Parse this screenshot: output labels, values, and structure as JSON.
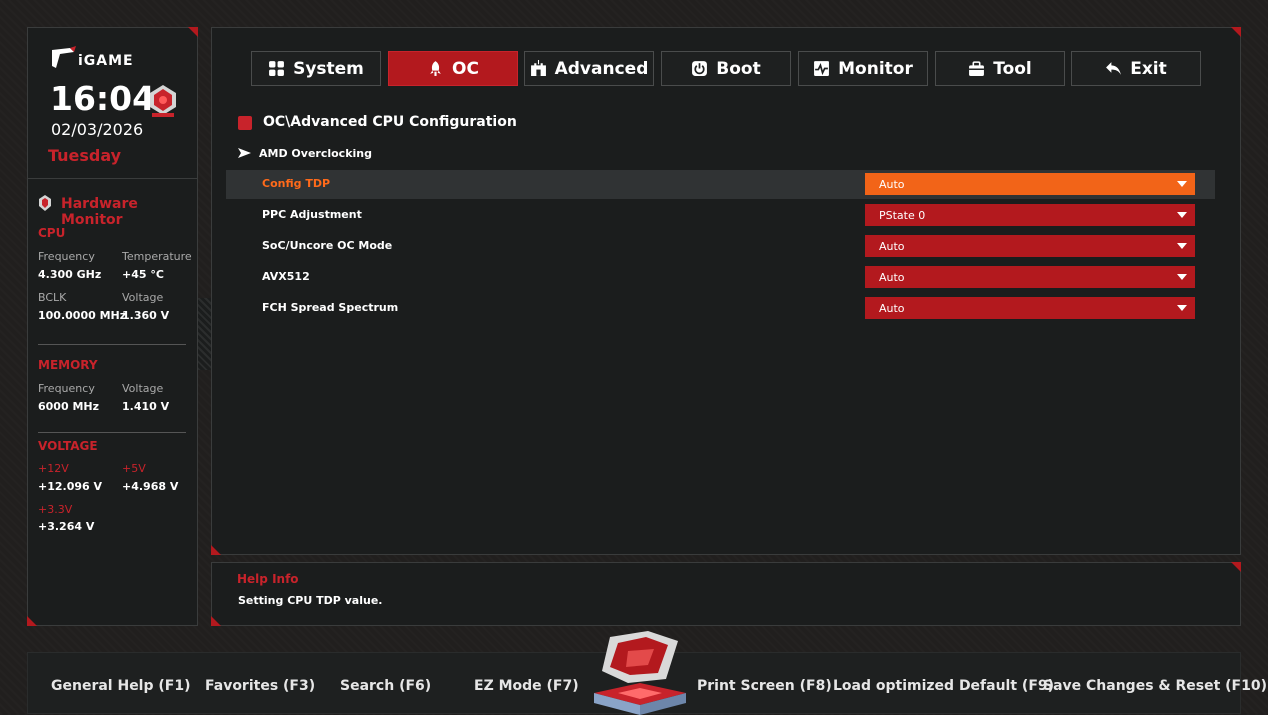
{
  "sidebar": {
    "brand": "iGAME",
    "time": "16:04",
    "date": "02/03/2026",
    "weekday": "Tuesday",
    "hardware_monitor_title": "Hardware Monitor",
    "cpu": {
      "heading": "CPU",
      "frequency_label": "Frequency",
      "frequency_value": "4.300 GHz",
      "temperature_label": "Temperature",
      "temperature_value": "+45 °C",
      "bclk_label": "BCLK",
      "bclk_value": "100.0000 MHz",
      "voltage_label": "Voltage",
      "voltage_value": "1.360 V"
    },
    "memory": {
      "heading": "MEMORY",
      "frequency_label": "Frequency",
      "frequency_value": "6000 MHz",
      "voltage_label": "Voltage",
      "voltage_value": "1.410 V"
    },
    "voltage": {
      "heading": "VOLTAGE",
      "v12_label": "+12V",
      "v12_value": "+12.096 V",
      "v5_label": "+5V",
      "v5_value": "+4.968 V",
      "v33_label": "+3.3V",
      "v33_value": "+3.264 V"
    }
  },
  "tabs": [
    {
      "label": "System",
      "icon": "grid-icon"
    },
    {
      "label": "OC",
      "icon": "rocket-icon"
    },
    {
      "label": "Advanced",
      "icon": "castle-icon"
    },
    {
      "label": "Boot",
      "icon": "power-icon"
    },
    {
      "label": "Monitor",
      "icon": "pulse-icon"
    },
    {
      "label": "Tool",
      "icon": "toolbox-icon"
    },
    {
      "label": "Exit",
      "icon": "back-arrow-icon"
    }
  ],
  "active_tab": "OC",
  "main": {
    "breadcrumb": "OC\\Advanced CPU Configuration",
    "submenu": "AMD Overclocking",
    "settings": [
      {
        "label": "Config TDP",
        "value": "Auto"
      },
      {
        "label": "PPC Adjustment",
        "value": "PState 0"
      },
      {
        "label": "SoC/Uncore OC Mode",
        "value": "Auto"
      },
      {
        "label": "AVX512",
        "value": "Auto"
      },
      {
        "label": "FCH Spread Spectrum",
        "value": "Auto"
      }
    ]
  },
  "help": {
    "title": "Help Info",
    "text": "Setting CPU TDP value."
  },
  "footer": {
    "general_help": "General Help (F1)",
    "favorites": "Favorites (F3)",
    "search": "Search (F6)",
    "ez_mode": "EZ Mode (F7)",
    "print_screen": "Print Screen (F8)",
    "load_default": "Load optimized Default (F9)",
    "save_reset": "Save Changes & Reset (F10)"
  },
  "colors": {
    "accent_red": "#b3191e",
    "highlight_orange": "#f26418",
    "label_red": "#c8232b"
  }
}
